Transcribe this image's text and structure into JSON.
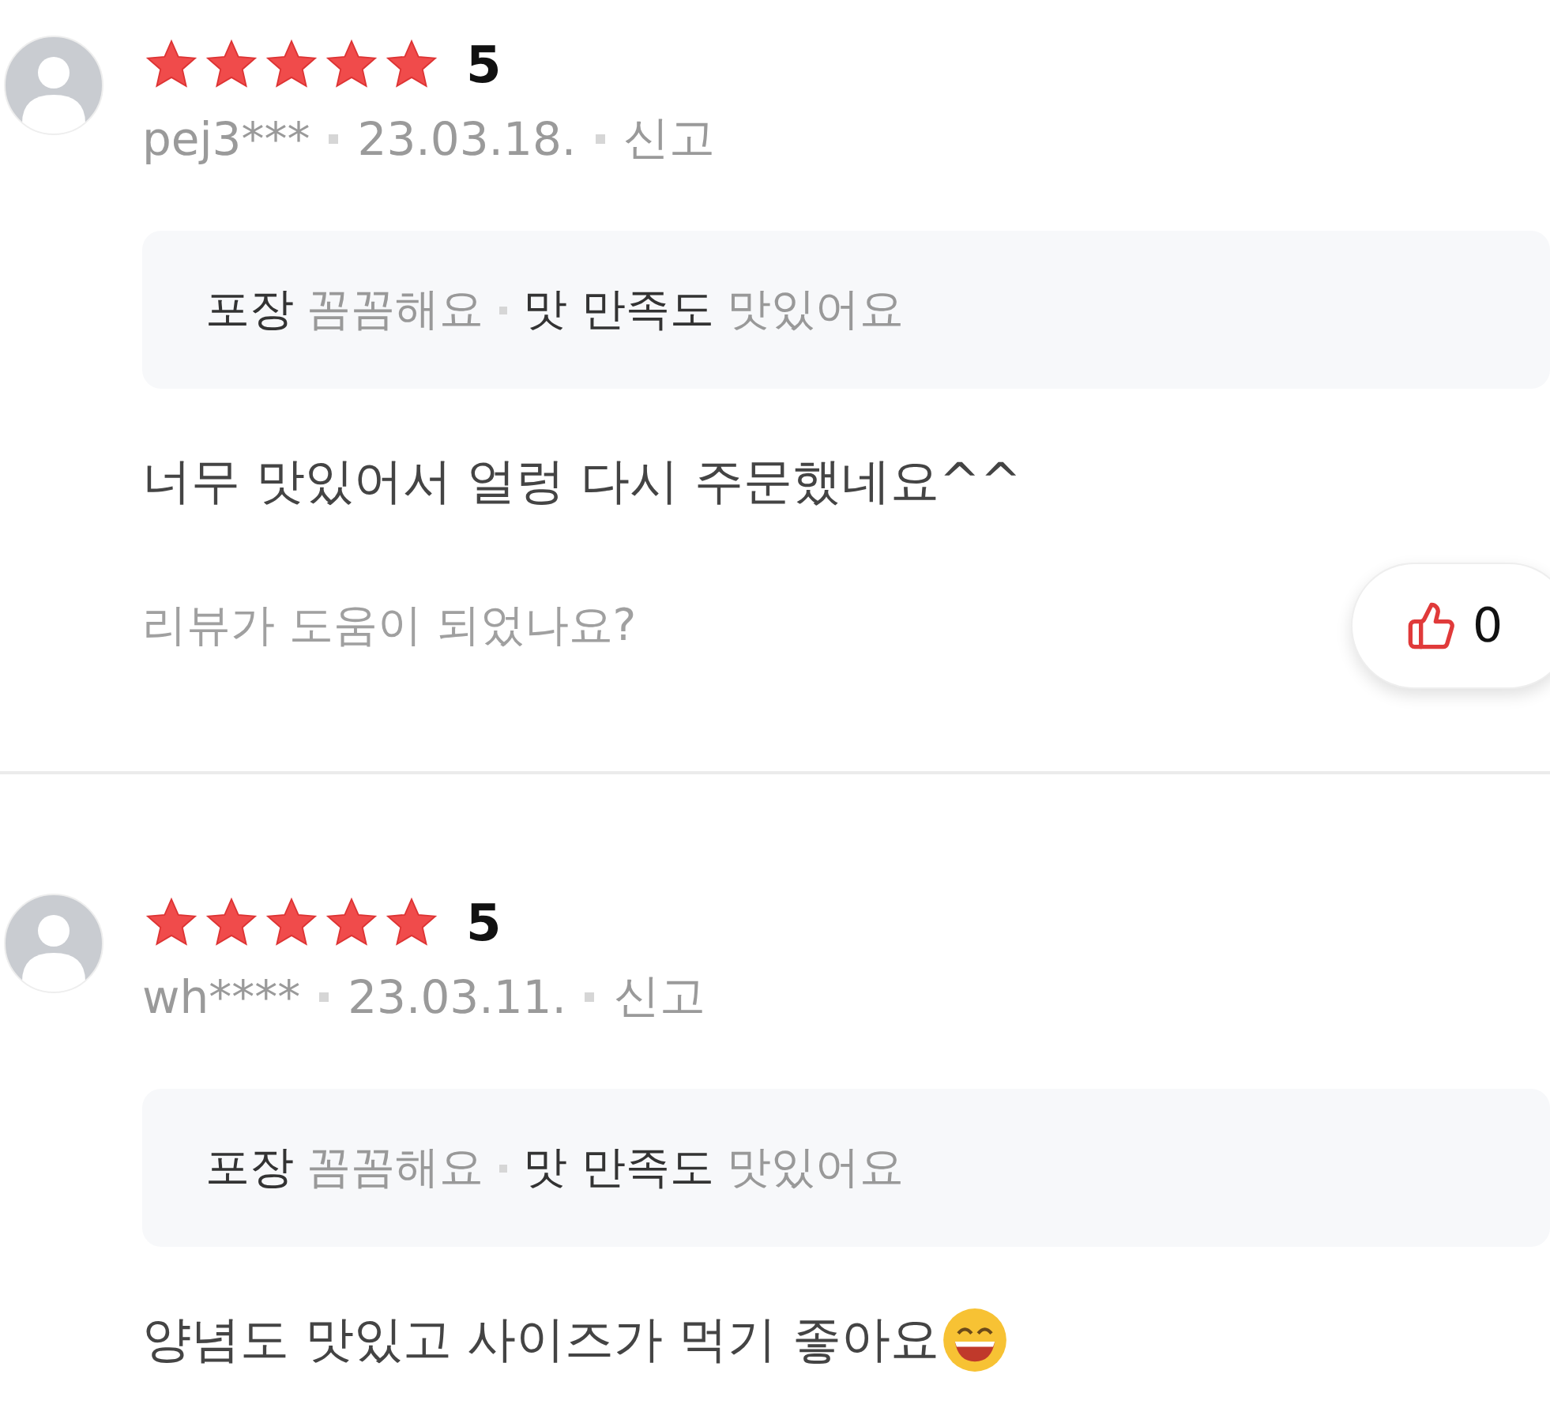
{
  "reviews": [
    {
      "stars": 5,
      "rating": "5",
      "user": "pej3***",
      "date": "23.03.18.",
      "report": "신고",
      "tags": [
        {
          "label": "포장",
          "value": "꼼꼼해요"
        },
        {
          "label": "맛 만족도",
          "value": "맛있어요"
        }
      ],
      "text": "너무 맛있어서 얼렁 다시 주문했네요^^",
      "has_emoji": false,
      "helpful_prompt": "리뷰가 도움이 되었나요?",
      "helpful_count": "0"
    },
    {
      "stars": 5,
      "rating": "5",
      "user": "wh****",
      "date": "23.03.11.",
      "report": "신고",
      "tags": [
        {
          "label": "포장",
          "value": "꼼꼼해요"
        },
        {
          "label": "맛 만족도",
          "value": "맛있어요"
        }
      ],
      "text": "양념도 맛있고 사이즈가 먹기 좋아요",
      "has_emoji": true
    }
  ]
}
